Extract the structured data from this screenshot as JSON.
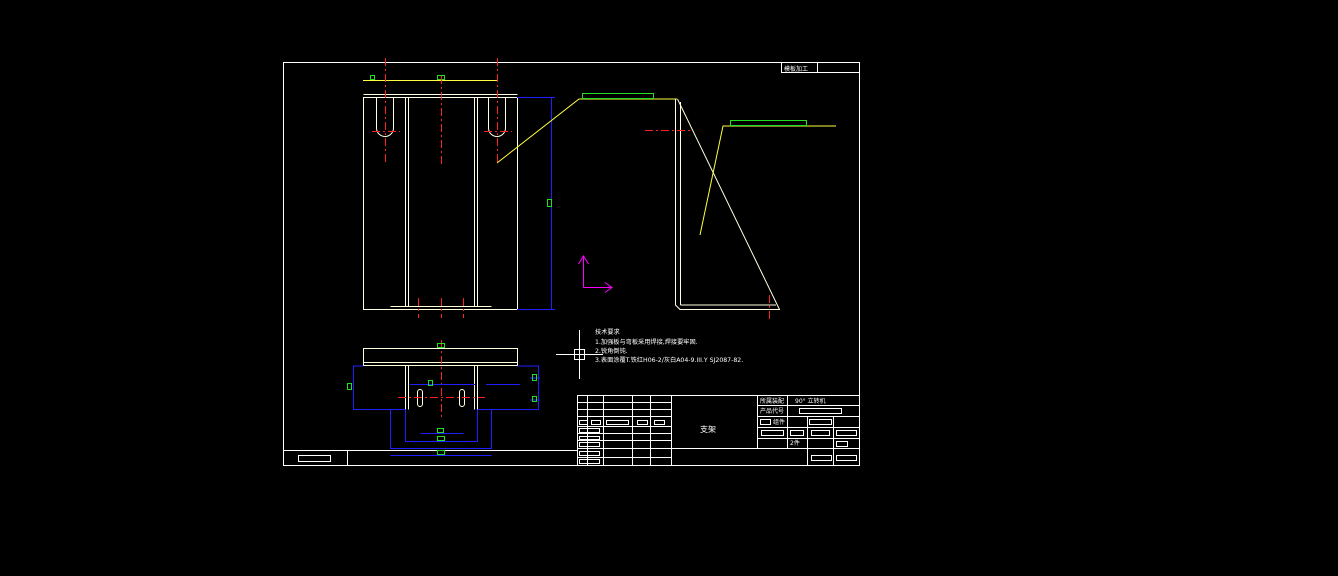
{
  "viewport": {
    "background": "#000000"
  },
  "colors": {
    "border": "#ffffff",
    "outline": "#ffffe0",
    "centerline": "#ff2020",
    "dimension": "#2020ff",
    "dimension_text": "#20e020",
    "ucs": "#ff00ff",
    "hatch_yellow": "#ffff40"
  },
  "title_block": {
    "top_right_tag": "模板加工",
    "part_name": "支架",
    "project_label": "所属装配",
    "project_value": "90° 立转机",
    "product_code_label": "产品代号",
    "material_label": "组件",
    "sheet_label": "2件"
  },
  "tech_requirements": {
    "heading": "技术要求",
    "lines": [
      "1.加强板与弯板采用焊接,焊接要牢固.",
      "2.锐角倒钝.",
      "3.表面涂覆T.铁红H06-2/灰白A04-9.III.Y  SJ2087-82."
    ]
  },
  "icons": {
    "ucs": "ucs-axes-icon",
    "crosshair": "cursor-crosshair-icon"
  }
}
